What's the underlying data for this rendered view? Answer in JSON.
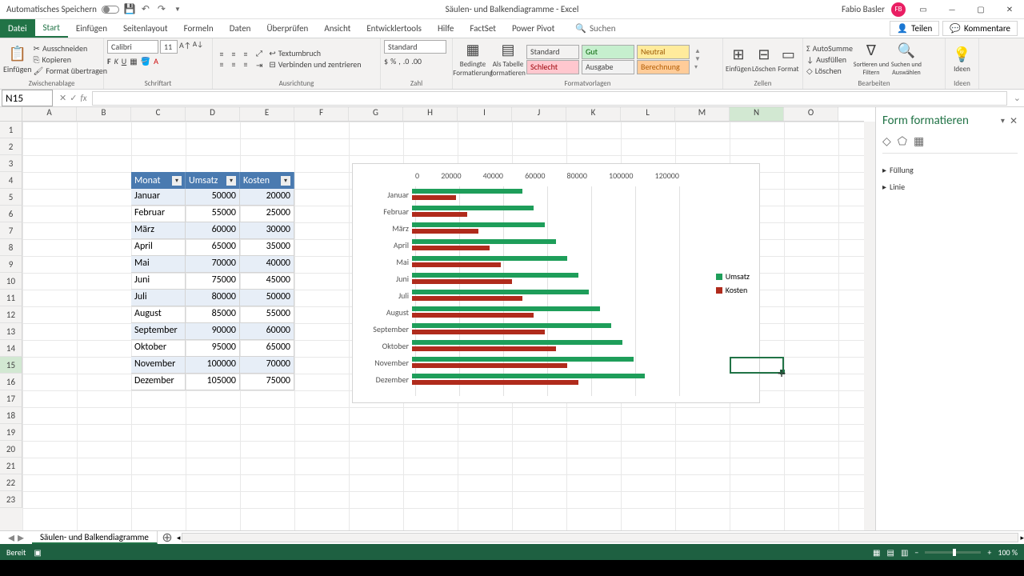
{
  "titlebar": {
    "autosave": "Automatisches Speichern",
    "doc_title": "Säulen- und Balkendiagramme - Excel",
    "user": "Fabio Basler",
    "avatar": "FB"
  },
  "tabs": {
    "file": "Datei",
    "items": [
      "Start",
      "Einfügen",
      "Seitenlayout",
      "Formeln",
      "Daten",
      "Überprüfen",
      "Ansicht",
      "Entwicklertools",
      "Hilfe",
      "FactSet",
      "Power Pivot"
    ],
    "search_icon": "🔍",
    "search": "Suchen",
    "share": "Teilen",
    "comments": "Kommentare"
  },
  "ribbon": {
    "paste": "Einfügen",
    "cut": "Ausschneiden",
    "copy": "Kopieren",
    "format_painter": "Format übertragen",
    "clipboard_label": "Zwischenablage",
    "font_name": "Calibri",
    "font_size": "11",
    "font_label": "Schriftart",
    "align_label": "Ausrichtung",
    "wrap": "Textumbruch",
    "merge": "Verbinden und zentrieren",
    "number_format": "Standard",
    "number_label": "Zahl",
    "cond_format": "Bedingte\nFormatierung",
    "as_table": "Als Tabelle\nformatieren",
    "style_standard": "Standard",
    "style_gut": "Gut",
    "style_neutral": "Neutral",
    "style_schlecht": "Schlecht",
    "style_ausgabe": "Ausgabe",
    "style_berechnung": "Berechnung",
    "styles_label": "Formatvorlagen",
    "insert": "Einfügen",
    "delete": "Löschen",
    "format": "Format",
    "cells_label": "Zellen",
    "autosum": "AutoSumme",
    "fill": "Ausfüllen",
    "clear": "Löschen",
    "sort_filter": "Sortieren und\nFiltern",
    "find_select": "Suchen und\nAuswählen",
    "edit_label": "Bearbeiten",
    "ideas": "Ideen",
    "ideas_label": "Ideen"
  },
  "formula": {
    "name_box": "N15",
    "fx": "fx"
  },
  "columns": [
    "A",
    "B",
    "C",
    "D",
    "E",
    "F",
    "G",
    "H",
    "I",
    "J",
    "K",
    "L",
    "M",
    "N",
    "O"
  ],
  "rows": [
    1,
    2,
    3,
    4,
    5,
    6,
    7,
    8,
    9,
    10,
    11,
    12,
    13,
    14,
    15,
    16,
    17,
    18,
    19,
    20,
    21,
    22,
    23
  ],
  "selected": {
    "col_index": 13,
    "row_index": 14
  },
  "table": {
    "headers": [
      "Monat",
      "Umsatz",
      "Kosten"
    ],
    "rows": [
      [
        "Januar",
        50000,
        20000
      ],
      [
        "Februar",
        55000,
        25000
      ],
      [
        "März",
        60000,
        30000
      ],
      [
        "April",
        65000,
        35000
      ],
      [
        "Mai",
        70000,
        40000
      ],
      [
        "Juni",
        75000,
        45000
      ],
      [
        "Juli",
        80000,
        50000
      ],
      [
        "August",
        85000,
        55000
      ],
      [
        "September",
        90000,
        60000
      ],
      [
        "Oktober",
        95000,
        65000
      ],
      [
        "November",
        100000,
        70000
      ],
      [
        "Dezember",
        105000,
        75000
      ]
    ]
  },
  "chart_data": {
    "type": "bar",
    "orientation": "horizontal",
    "categories": [
      "Januar",
      "Februar",
      "März",
      "April",
      "Mai",
      "Juni",
      "Juli",
      "August",
      "September",
      "Oktober",
      "November",
      "Dezember"
    ],
    "series": [
      {
        "name": "Umsatz",
        "color": "#1e9e5a",
        "values": [
          50000,
          55000,
          60000,
          65000,
          70000,
          75000,
          80000,
          85000,
          90000,
          95000,
          100000,
          105000
        ]
      },
      {
        "name": "Kosten",
        "color": "#b02b1c",
        "values": [
          20000,
          25000,
          30000,
          35000,
          40000,
          45000,
          50000,
          55000,
          60000,
          65000,
          70000,
          75000
        ]
      }
    ],
    "x_ticks": [
      0,
      20000,
      40000,
      60000,
      80000,
      100000,
      120000
    ],
    "xlim": [
      0,
      120000
    ],
    "xlabel": "",
    "ylabel": "",
    "title": ""
  },
  "side_panel": {
    "title": "Form formatieren",
    "sections": [
      "Füllung",
      "Linie"
    ]
  },
  "sheet_tab": "Säulen- und Balkendiagramme",
  "status": {
    "ready": "Bereit",
    "zoom": "100 %"
  }
}
